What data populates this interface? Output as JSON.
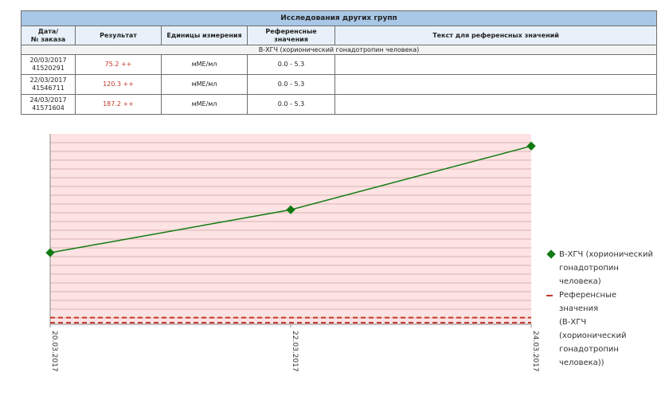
{
  "table": {
    "title": "Исследования других групп",
    "columns": [
      "Дата/\n№ заказа",
      "Результат",
      "Единицы измерения",
      "Референсные\nзначения",
      "Текст для референсных значений"
    ],
    "group_label": "В-ХГЧ (хорионический гонадотропин человека)",
    "rows": [
      {
        "date": "20/03/2017",
        "order": "41520291",
        "result": "75.2 ++",
        "units": "мМЕ/мл",
        "reference": "0.0 - 5.3",
        "ref_text": ""
      },
      {
        "date": "22/03/2017",
        "order": "41546711",
        "result": "120.3 ++",
        "units": "мМЕ/мл",
        "reference": "0.0 - 5.3",
        "ref_text": ""
      },
      {
        "date": "24/03/2017",
        "order": "41571604",
        "result": "187.2 ++",
        "units": "мМЕ/мл",
        "reference": "0.0 - 5.3",
        "ref_text": ""
      }
    ]
  },
  "chart_data": {
    "type": "line",
    "categories": [
      "20.03.2017",
      "22.03.2017",
      "24.03.2017"
    ],
    "series": [
      {
        "name": "В-ХГЧ (хорионический гонадотропин человека)",
        "values": [
          75.2,
          120.3,
          187.2
        ],
        "color": "#117a11",
        "marker": "diamond"
      },
      {
        "name": "Референсные значения (В-ХГЧ (хорионический гонадотропин человека))",
        "lower": 0.0,
        "upper": 5.3,
        "color": "#c0392b",
        "style": "dashed"
      }
    ],
    "ylim": [
      0,
      200
    ],
    "grid": true,
    "background": "#fde3e3",
    "legend_position": "right"
  },
  "legend": [
    {
      "line1": "В-ХГЧ (хорионический",
      "line2": "гонадотропин",
      "line3": "человека)",
      "line4": ""
    },
    {
      "line1": "Референсные значения",
      "line2": "(В-ХГЧ (хорионический",
      "line3": "гонадотропин",
      "line4": "человека))"
    }
  ]
}
